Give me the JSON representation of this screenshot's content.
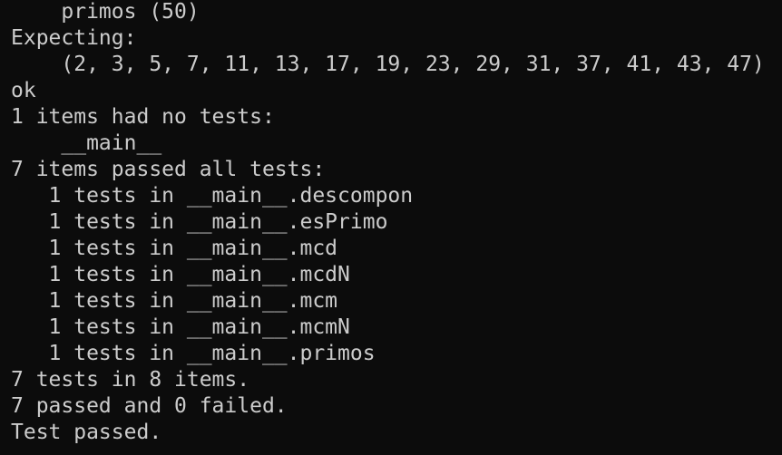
{
  "terminal": {
    "background": "#0c0c0c",
    "foreground": "#cccccc",
    "lines": [
      "    primos (50)",
      "Expecting:",
      "    (2, 3, 5, 7, 11, 13, 17, 19, 23, 29, 31, 37, 41, 43, 47)",
      "ok",
      "1 items had no tests:",
      "    __main__",
      "7 items passed all tests:",
      "   1 tests in __main__.descompon",
      "   1 tests in __main__.esPrimo",
      "   1 tests in __main__.mcd",
      "   1 tests in __main__.mcdN",
      "   1 tests in __main__.mcm",
      "   1 tests in __main__.mcmN",
      "   1 tests in __main__.primos",
      "7 tests in 8 items.",
      "7 passed and 0 failed.",
      "Test passed."
    ]
  }
}
